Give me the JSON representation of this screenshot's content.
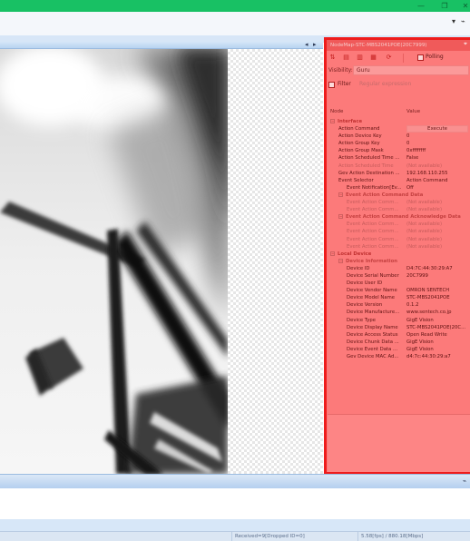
{
  "window": {
    "minimize_glyph": "—",
    "restore_glyph": "❐",
    "close_glyph": "✕",
    "pin_glyph": "⌁",
    "accent_color": "#18c164"
  },
  "view": {
    "nav_left": "◂",
    "nav_right": "▸"
  },
  "panel": {
    "title": "NodeMap-STC-MBS2041POE(20C7999)",
    "pin_glyph": "⌖",
    "highlight_color": "#ee1c1c",
    "toolbar": {
      "sort_icon": "sort-az-icon",
      "polling_label": "Polling"
    },
    "visibility_label": "Visibility:",
    "visibility_value": "Guru",
    "filter_label": "Filter",
    "filter_placeholder": "Regular expression",
    "col_node": "Node",
    "col_value": "Value"
  },
  "rows": [
    {
      "indent": 0,
      "kind": "cat",
      "label": "Interface",
      "value": ""
    },
    {
      "indent": 1,
      "kind": "item",
      "label": "Action Command",
      "value": "Execute",
      "button": true
    },
    {
      "indent": 1,
      "kind": "item",
      "label": "Action Device Key",
      "value": "0"
    },
    {
      "indent": 1,
      "kind": "item",
      "label": "Action Group Key",
      "value": "0"
    },
    {
      "indent": 1,
      "kind": "item",
      "label": "Action Group Mask",
      "value": "0xffffffff"
    },
    {
      "indent": 1,
      "kind": "item",
      "label": "Action Scheduled Time ...",
      "value": "False"
    },
    {
      "indent": 1,
      "kind": "dim",
      "label": "Action Scheduled Time",
      "value": "(Not available)"
    },
    {
      "indent": 1,
      "kind": "item",
      "label": "Gev Action Destination ...",
      "value": "192.168.110.255"
    },
    {
      "indent": 1,
      "kind": "item",
      "label": "Event Selector",
      "value": "Action Command"
    },
    {
      "indent": 2,
      "kind": "item",
      "label": "Event Notification[Ev...",
      "value": "Off"
    },
    {
      "indent": 1,
      "kind": "cat2",
      "label": "Event Action Command Data",
      "value": ""
    },
    {
      "indent": 2,
      "kind": "dim",
      "label": "Event Action Comm...",
      "value": "(Not available)"
    },
    {
      "indent": 2,
      "kind": "dim",
      "label": "Event Action Comm...",
      "value": "(Not available)"
    },
    {
      "indent": 1,
      "kind": "cat2",
      "label": "Event Action Command Acknowledge Data",
      "value": ""
    },
    {
      "indent": 2,
      "kind": "dim",
      "label": "Event Action Comm...",
      "value": "(Not available)"
    },
    {
      "indent": 2,
      "kind": "dim",
      "label": "Event Action Comm...",
      "value": "(Not available)"
    },
    {
      "indent": 2,
      "kind": "dim",
      "label": "Event Action Comm...",
      "value": "(Not available)"
    },
    {
      "indent": 2,
      "kind": "dim",
      "label": "Event Action Comm...",
      "value": "(Not available)"
    },
    {
      "indent": 0,
      "kind": "cat",
      "label": "Local Device",
      "value": ""
    },
    {
      "indent": 1,
      "kind": "cat2",
      "label": "Device Information",
      "value": ""
    },
    {
      "indent": 2,
      "kind": "item",
      "label": "Device ID",
      "value": "D4:7C:44:30:29:A7"
    },
    {
      "indent": 2,
      "kind": "item",
      "label": "Device Serial Number",
      "value": "20C7999"
    },
    {
      "indent": 2,
      "kind": "item",
      "label": "Device User ID",
      "value": ""
    },
    {
      "indent": 2,
      "kind": "item",
      "label": "Device Vendor Name",
      "value": "OMRON SENTECH"
    },
    {
      "indent": 2,
      "kind": "item",
      "label": "Device Model Name",
      "value": "STC-MBS2041POE"
    },
    {
      "indent": 2,
      "kind": "item",
      "label": "Device Version",
      "value": "0.1.2"
    },
    {
      "indent": 2,
      "kind": "item",
      "label": "Device Manufacture...",
      "value": "www.sentech.co.jp"
    },
    {
      "indent": 2,
      "kind": "item",
      "label": "Device Type",
      "value": "GigE Vision"
    },
    {
      "indent": 2,
      "kind": "item",
      "label": "Device Display Name",
      "value": "STC-MBS2041POE(20C..."
    },
    {
      "indent": 2,
      "kind": "item",
      "label": "Device Access Status",
      "value": "Open Read Write"
    },
    {
      "indent": 2,
      "kind": "item",
      "label": "Device Chunk Data ...",
      "value": "GigE Vision"
    },
    {
      "indent": 2,
      "kind": "item",
      "label": "Device Event Data ...",
      "value": "GigE Vision"
    },
    {
      "indent": 2,
      "kind": "item",
      "label": "Gev Device MAC Ad...",
      "value": "d4:7c:44:30:29:a7"
    }
  ],
  "statusbar": {
    "received": "Received=9[Dropped ID=0]",
    "fps": "5.58[fps] / 880.18[Mbps]"
  }
}
